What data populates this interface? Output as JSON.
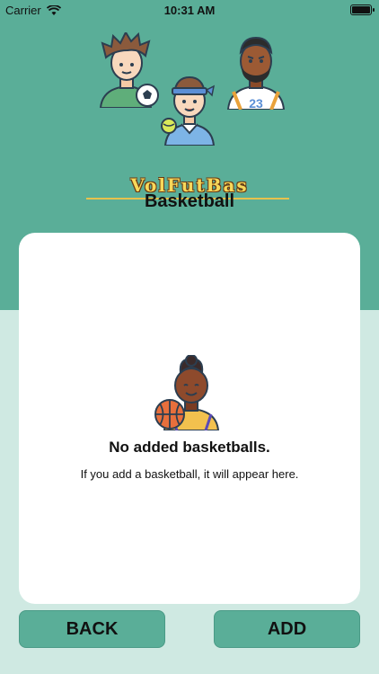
{
  "status_bar": {
    "carrier": "Carrier",
    "time": "10:31 AM"
  },
  "header": {
    "logo_text": "VolFutBas",
    "section_title": "Basketball"
  },
  "empty_state": {
    "title": "No added basketballs.",
    "subtitle": "If you add a basketball, it will appear here."
  },
  "buttons": {
    "back_label": "BACK",
    "add_label": "ADD"
  },
  "colors": {
    "header_bg": "#5aae98",
    "page_bg": "#cfe9e2",
    "card_bg": "#ffffff",
    "button_bg": "#5aae98",
    "logo_fill": "#f7d85a"
  },
  "icons": [
    "wifi-icon",
    "battery-icon",
    "soccer-player-avatar",
    "volleyball-player-avatar",
    "basketball-player-avatar",
    "basketball-player-illustration"
  ]
}
